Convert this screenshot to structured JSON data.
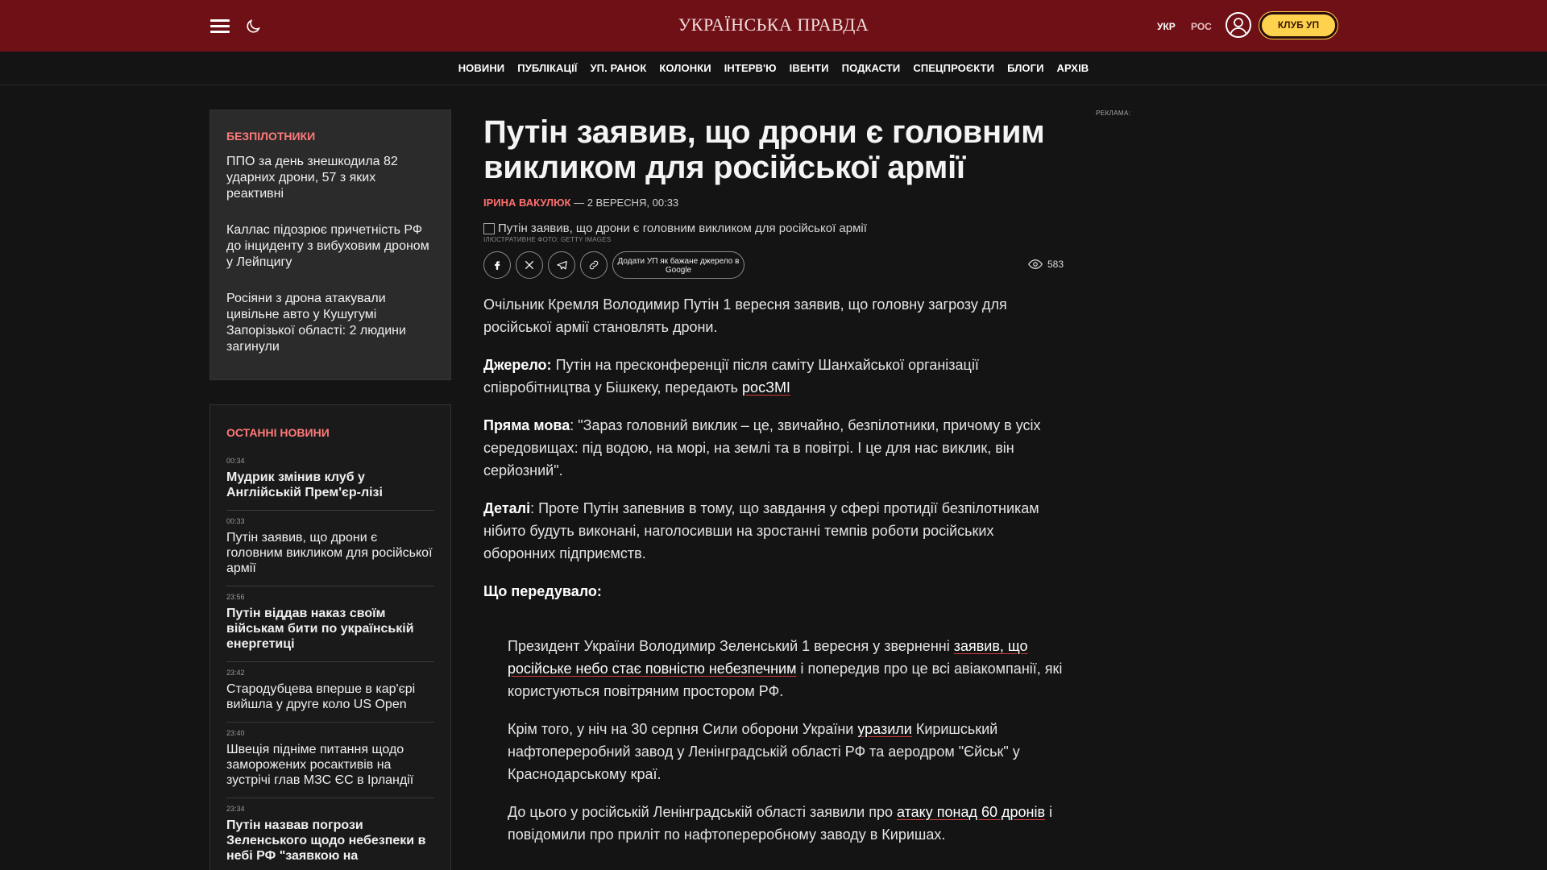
{
  "header": {
    "logo": "УКРАЇНСЬКА ПРАВДА",
    "lang_ukr": "УКР",
    "lang_ros": "РОС",
    "club_button": "КЛУБ УП",
    "accent_color": "#6e1016"
  },
  "nav": {
    "items": [
      "НОВИНИ",
      "ПУБЛІКАЦІЇ",
      "УП. РАНОК",
      "КОЛОНКИ",
      "ІНТЕРВ'Ю",
      "ІВЕНТИ",
      "ПОДКАСТИ",
      "СПЕЦПРОЄКТИ",
      "БЛОГИ",
      "АРХІВ"
    ]
  },
  "topic_box": {
    "title": "БЕЗПІЛОТНИКИ",
    "items": [
      "ППО за день знешкодила 82 ударних дрони, 57 з яких реактивні",
      "Каллас підозрює причетність РФ до інциденту з вибуховим дроном у Лейпцигу",
      "Росіяни з дрона атакували цивільне авто у Кушугумі Запорізької області: 2 людини загинули"
    ]
  },
  "latest_news": {
    "title": "ОСТАННІ НОВИНИ",
    "items": [
      {
        "time": "00:34",
        "text": "Мудрик змінив клуб у Англійській Прем'єр-лізі",
        "bold": true
      },
      {
        "time": "00:33",
        "text": "Путін заявив, що дрони є головним викликом для російської армії",
        "bold": false
      },
      {
        "time": "23:56",
        "text": "Путін віддав наказ своїм військам бити по українській енергетиці",
        "bold": true
      },
      {
        "time": "23:42",
        "text": "Стародубцева вперше в кар'єрі вийшла у друге коло US Open",
        "bold": false
      },
      {
        "time": "23:40",
        "text": "Швеція підніме питання щодо заморожених росактивів на зустрічі глав МЗС ЄС в Ірландії",
        "bold": false
      },
      {
        "time": "23:34",
        "text": "Путін назвав погрози Зеленського щодо небезпеки в небі РФ \"заявкою на",
        "bold": true
      }
    ]
  },
  "article": {
    "title": "Путін заявив, що дрони є головним викликом для російської армії",
    "author": "ІРИНА ВАКУЛЮК",
    "date": "— 2 ВЕРЕСНЯ, 00:33",
    "image_alt": "Путін заявив, що дрони є головним викликом для російської армії",
    "image_caption": "ІЛЮСТРАТИВНЕ ФОТО: GETTY IMAGES",
    "google_button": "Додати УП як бажане джерело в Google",
    "views": "583",
    "p1": "Очільник Кремля Володимир Путін 1 вересня заявив, що головну загрозу для російської армії становлять дрони.",
    "p2_label": "Джерело:",
    "p2_text": " Путін на пресконференції після саміту Шанхайської організації співробітництва у Бішкеку, передають ",
    "p2_link": "росЗМІ",
    "p3_label": "Пряма мова",
    "p3_text": ": \"Зараз головний виклик – це, звичайно, безпілотники, причому в усіх середовищах: під водою, на морі, на землі та в повітрі. І це для нас виклик, він серйозний\".",
    "p4_label": "Деталі",
    "p4_text": ": Проте Путін запевнив в тому, що завдання у сфері протидії безпілотникам нібито будуть виконані, наголосивши на зростанні темпів роботи російських оборонних підприємств.",
    "p5_label": "Що передувало:",
    "q1_a": "Президент України Володимир Зеленський 1 вересня у зверненні ",
    "q1_link": "заявив, що російське небо стає повністю небезпечним",
    "q1_b": " і попередив про це всі авіакомпанії, які користуються повітряним простором РФ.",
    "q2_a": "Крім того, у ніч на 30 серпня Сили оборони України ",
    "q2_link": "уразили",
    "q2_b": " Киришський нафтопереробний завод у Ленінградській області РФ та аеродром \"Єйськ\" у Краснодарському краї.",
    "q3_a": "До цього у російській Ленінградській області заявили про ",
    "q3_link": "атаку понад 60 дронів",
    "q3_b": " і повідомили про приліт по нафтопереробному заводу в Киришах."
  },
  "ad_label": "РЕКЛАМА:"
}
